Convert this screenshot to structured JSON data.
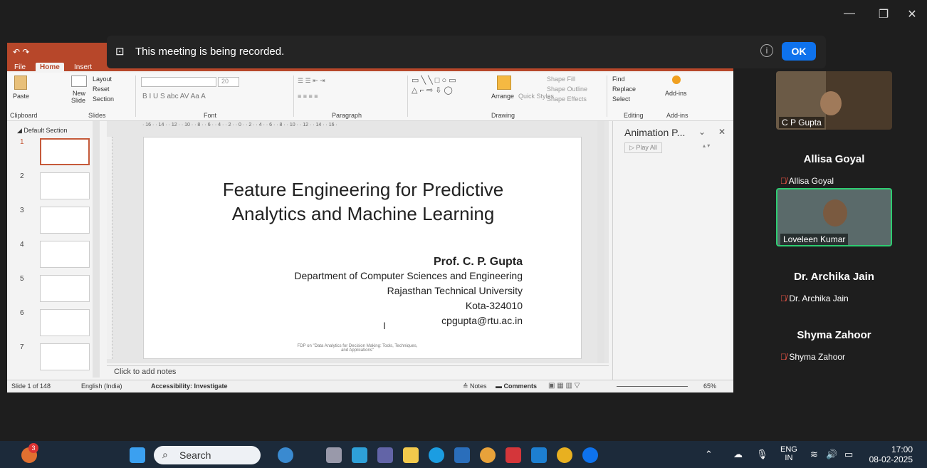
{
  "window": {
    "minimize": "—",
    "restore": "❐",
    "close": "✕"
  },
  "banner": {
    "message": "This meeting is being recorded.",
    "info": "i",
    "ok_label": "OK"
  },
  "ppt": {
    "tabs": [
      "File",
      "Home",
      "Insert"
    ],
    "ribbon": {
      "paste": "Paste",
      "new_slide_line1": "New",
      "new_slide_line2": "Slide",
      "layout": "Layout",
      "reset": "Reset",
      "section": "Section",
      "font_size": "20",
      "arrange": "Arrange",
      "quick_styles": "Quick Styles",
      "shape_fill": "Shape Fill",
      "shape_outline": "Shape Outline",
      "shape_effects": "Shape Effects",
      "find": "Find",
      "replace": "Replace",
      "select": "Select",
      "addins": "Add-ins",
      "groups": {
        "clipboard": "Clipboard",
        "slides": "Slides",
        "font": "Font",
        "paragraph": "Paragraph",
        "drawing": "Drawing",
        "editing": "Editing",
        "addins": "Add-ins"
      }
    },
    "thumbnails": {
      "section_label": "Default Section",
      "numbers": [
        "1",
        "2",
        "3",
        "4",
        "5",
        "6",
        "7"
      ]
    },
    "ruler": "· 16 · · 14 · · 12 · · 10 · · 8 · · 6 · · 4 · · 2 · · 0 · · 2 · · 4 · · 6 · · 8 · · 10 · · 12 · · 14 · · 16 ·",
    "slide": {
      "title_line1": "Feature Engineering for Predictive",
      "title_line2": "Analytics and Machine Learning",
      "author": "Prof. C. P. Gupta",
      "dept": "Department of Computer Sciences and Engineering",
      "univ": "Rajasthan Technical University",
      "city": "Kota-324010",
      "email": "cpgupta@rtu.ac.in",
      "footer_line1": "FDP on \"Data Analytics for Decision Making: Tools, Techniques,",
      "footer_line2": "and Applications\""
    },
    "notes_placeholder": "Click to add notes",
    "animation_pane": {
      "title": "Animation P...",
      "play_all": "Play All"
    },
    "status": {
      "slide_count": "Slide 1 of 148",
      "language": "English (India)",
      "accessibility": "Accessibility: Investigate",
      "notes": "Notes",
      "comments": "Comments",
      "zoom": "65%"
    }
  },
  "participants": [
    {
      "label": "C P Gupta"
    },
    {
      "name": "Allisa Goyal",
      "label": "Allisa Goyal"
    },
    {
      "label": "Loveleen Kumar"
    },
    {
      "name": "Dr. Archika Jain",
      "label": "Dr. Archika Jain"
    },
    {
      "name": "Shyma Zahoor",
      "label": "Shyma Zahoor"
    }
  ],
  "taskbar": {
    "search_placeholder": "Search",
    "badge_count": "3",
    "lang_line1": "ENG",
    "lang_line2": "IN",
    "time": "17:00",
    "date": "08-02-2025"
  },
  "colors": {
    "ppt_accent": "#b7472a",
    "zoom_ok": "#0e72ed",
    "active_speaker": "#2ecc71",
    "muted": "#ff5a4a"
  }
}
